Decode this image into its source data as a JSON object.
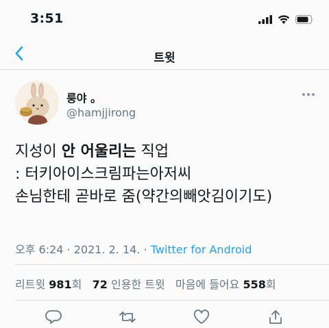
{
  "status_bar": {
    "time": "3:51"
  },
  "nav": {
    "title": "트윗"
  },
  "author": {
    "display_name": "룽야 。",
    "username": "@hamjjirong"
  },
  "tweet": {
    "line1_a": "지성이 ",
    "line1_b": "안 어울리는",
    "line1_c": " 직업",
    "line2": " : 터키아이스크림파는아저씨",
    "line3": "손님한테 곧바로 줌(약간의빼앗김이기도)"
  },
  "meta": {
    "time": "오후 6:24",
    "sep1": " · ",
    "date": "2021. 2. 14.",
    "sep2": " · ",
    "source": "Twitter for Android"
  },
  "stats": {
    "retweets_label": "리트윗 ",
    "retweets_count": "981",
    "retweets_unit": "회",
    "quotes_count": "72",
    "quotes_label": " 인용한 트윗",
    "likes_label": "마음에 들어요 ",
    "likes_count": "558",
    "likes_unit": "회"
  },
  "colors": {
    "accent": "#1da1f2",
    "secondary_text": "#657786",
    "divider": "#d8dde1"
  }
}
